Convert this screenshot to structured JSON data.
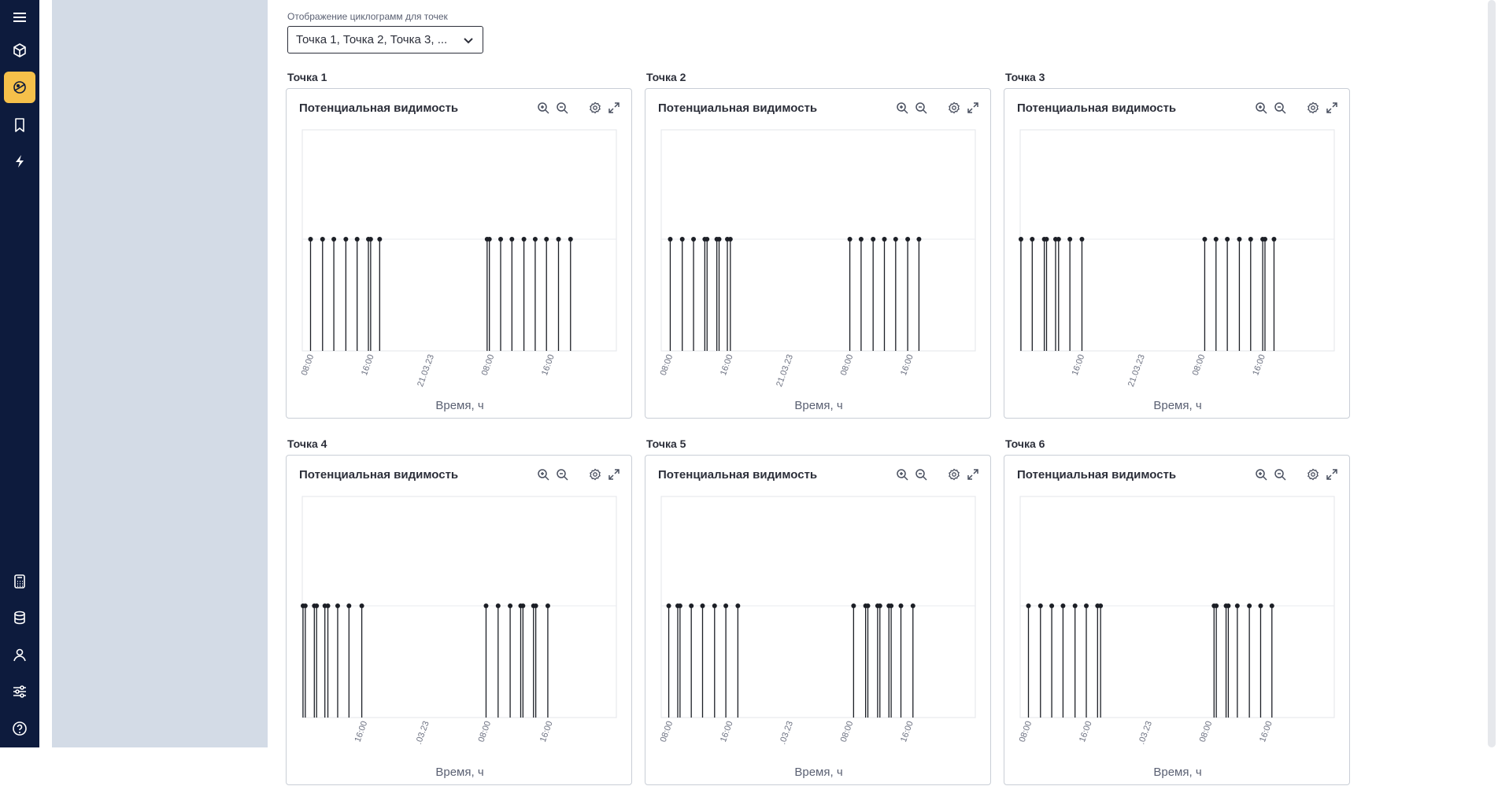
{
  "sidebar": {
    "top_items": [
      {
        "icon": "menu-icon",
        "active": false
      },
      {
        "icon": "cube-icon",
        "active": false
      },
      {
        "icon": "orbit-icon",
        "active": true
      },
      {
        "icon": "bookmark-icon",
        "active": false
      },
      {
        "icon": "lightning-icon",
        "active": false
      }
    ],
    "bottom_items": [
      {
        "icon": "calculator-icon"
      },
      {
        "icon": "database-icon"
      },
      {
        "icon": "user-icon"
      },
      {
        "icon": "sliders-icon"
      },
      {
        "icon": "help-icon"
      }
    ],
    "accent_color": "#f5c04a",
    "bg_color": "#0d1b3d"
  },
  "selector": {
    "label": "Отображение циклограмм для точек",
    "value": "Точка 1, Точка 2, Точка 3, ..."
  },
  "card_common": {
    "chart_title": "Потенциальная видимость",
    "x_label": "Время, ч",
    "tools": [
      "zoom-in-icon",
      "zoom-out-icon",
      "settings-icon",
      "expand-icon"
    ]
  },
  "points": [
    {
      "title": "Точка 1"
    },
    {
      "title": "Точка 2"
    },
    {
      "title": "Точка 3"
    },
    {
      "title": "Точка 4"
    },
    {
      "title": "Точка 5"
    },
    {
      "title": "Точка 6"
    }
  ],
  "chart_data": [
    {
      "type": "scatter",
      "title": "Потенциальная видимость",
      "xlabel": "Время, ч",
      "ylabel": "",
      "x_range_hours": [
        6.9,
        48.7
      ],
      "ticks": [
        {
          "h": 8,
          "label": "08:00"
        },
        {
          "h": 16,
          "label": "16:00"
        },
        {
          "h": 24,
          "label": "21.03.23"
        },
        {
          "h": 32,
          "label": "08:00"
        },
        {
          "h": 40,
          "label": "16:00"
        }
      ],
      "events_hours": [
        8.0,
        9.6,
        11.1,
        12.7,
        14.2,
        15.7,
        16.0,
        17.2,
        31.5,
        31.8,
        33.3,
        34.8,
        36.4,
        37.9,
        39.4,
        41.0,
        42.6
      ]
    },
    {
      "type": "scatter",
      "title": "Потенциальная видимость",
      "xlabel": "Время, ч",
      "ylabel": "",
      "x_range_hours": [
        6.9,
        48.7
      ],
      "ticks": [
        {
          "h": 8,
          "label": "08:00"
        },
        {
          "h": 16,
          "label": "16:00"
        },
        {
          "h": 24,
          "label": "21.03.23"
        },
        {
          "h": 32,
          "label": "08:00"
        },
        {
          "h": 40,
          "label": "16:00"
        }
      ],
      "events_hours": [
        8.1,
        9.7,
        11.2,
        12.7,
        13.0,
        14.3,
        14.6,
        15.7,
        16.1,
        32.0,
        33.5,
        35.1,
        36.6,
        38.1,
        39.7,
        41.2
      ]
    },
    {
      "type": "scatter",
      "title": "Потенциальная видимость",
      "xlabel": "Время, ч",
      "ylabel": "",
      "x_range_hours": [
        7.9,
        49.6
      ],
      "ticks": [
        {
          "h": 16,
          "label": "16:00"
        },
        {
          "h": 24,
          "label": "21.03.23"
        },
        {
          "h": 32,
          "label": "08:00"
        },
        {
          "h": 40,
          "label": "16:00"
        }
      ],
      "events_hours": [
        8.0,
        9.5,
        11.1,
        11.4,
        12.6,
        13.0,
        14.5,
        16.1,
        32.4,
        33.9,
        35.4,
        37.0,
        38.5,
        40.1,
        40.4,
        41.6
      ]
    },
    {
      "type": "scatter",
      "title": "Потенциальная видимость",
      "xlabel": "Время, ч",
      "ylabel": "",
      "x_range_hours": [
        7.4,
        49.1
      ],
      "ticks": [
        {
          "h": 15.6,
          "label": "16:00"
        },
        {
          "h": 23.8,
          "label": ".03.23"
        },
        {
          "h": 32,
          "label": "08:00"
        },
        {
          "h": 40.2,
          "label": "16:00"
        }
      ],
      "events_hours": [
        7.5,
        7.8,
        9.0,
        9.3,
        10.4,
        10.8,
        12.1,
        13.6,
        15.3,
        31.8,
        33.4,
        35.0,
        36.4,
        36.7,
        38.1,
        38.4,
        40.0
      ]
    },
    {
      "type": "scatter",
      "title": "Потенциальная видимость",
      "xlabel": "Время, ч",
      "ylabel": "",
      "x_range_hours": [
        6.9,
        48.7
      ],
      "ticks": [
        {
          "h": 8,
          "label": "08:00"
        },
        {
          "h": 16,
          "label": "16:00"
        },
        {
          "h": 24,
          "label": ".03.23"
        },
        {
          "h": 32,
          "label": "08:00"
        },
        {
          "h": 40,
          "label": "16:00"
        }
      ],
      "events_hours": [
        7.9,
        9.1,
        9.4,
        10.9,
        12.4,
        14.0,
        15.5,
        17.1,
        32.5,
        34.1,
        34.4,
        35.7,
        36.0,
        37.2,
        37.5,
        38.8,
        40.4
      ]
    },
    {
      "type": "scatter",
      "title": "Потенциальная видимость",
      "xlabel": "Время, ч",
      "ylabel": "",
      "x_range_hours": [
        6.9,
        48.7
      ],
      "ticks": [
        {
          "h": 8,
          "label": "08:00"
        },
        {
          "h": 16,
          "label": "16:00"
        },
        {
          "h": 24,
          "label": ".03.23"
        },
        {
          "h": 32,
          "label": "08:00"
        },
        {
          "h": 40,
          "label": "16:00"
        }
      ],
      "events_hours": [
        8.0,
        9.6,
        11.1,
        12.6,
        14.2,
        15.7,
        17.2,
        17.6,
        32.7,
        33.0,
        34.3,
        34.6,
        35.8,
        37.4,
        38.9,
        40.4
      ]
    }
  ]
}
